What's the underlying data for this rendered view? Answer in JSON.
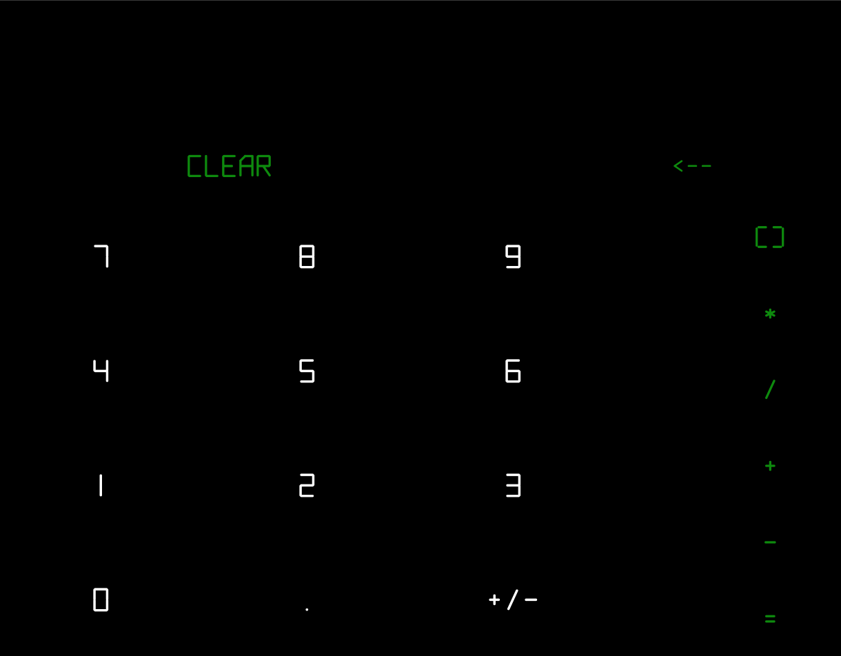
{
  "colors": {
    "background": "#000000",
    "digit": "#ffffff",
    "accent": "#0e8a0e"
  },
  "controls": {
    "clear_label": "CLEAR",
    "backspace_label": "<--"
  },
  "keypad": {
    "keys": [
      "7",
      "8",
      "9",
      "4",
      "5",
      "6",
      "1",
      "2",
      "3",
      "0",
      ".",
      "+/-"
    ]
  },
  "operators": {
    "keys": [
      "()",
      "*",
      "/",
      "+",
      "-",
      "="
    ]
  }
}
